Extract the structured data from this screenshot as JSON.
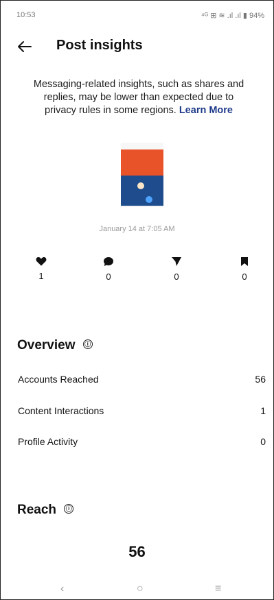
{
  "status_bar": {
    "time": "10:53",
    "indicators": "⁴ᴳ ⊞ ≋ .ıl .ıl ▮ 94%"
  },
  "header": {
    "title": "Post insights",
    "back_icon": "arrow-left-icon"
  },
  "notice": {
    "text": "Messaging-related insights, such as shares and replies, may be lower than expected due to privacy rules in some regions.",
    "link": "Learn More"
  },
  "post": {
    "date": "January 14 at 7:05 AM"
  },
  "stats": [
    {
      "icon": "heart-icon",
      "value": "1"
    },
    {
      "icon": "comment-icon",
      "value": "0"
    },
    {
      "icon": "share-icon",
      "value": "0"
    },
    {
      "icon": "bookmark-icon",
      "value": "0"
    }
  ],
  "overview": {
    "title": "Overview",
    "info_icon": "ⓘ",
    "rows": [
      {
        "label": "Accounts Reached",
        "value": "56"
      },
      {
        "label": "Content Interactions",
        "value": "1"
      },
      {
        "label": "Profile Activity",
        "value": "0"
      }
    ]
  },
  "reach": {
    "title": "Reach",
    "info_icon": "ⓘ",
    "total": "56"
  },
  "nav": {
    "back": "‹",
    "home": "○",
    "recents": "≡"
  },
  "colors": {
    "link": "#1e3a8a",
    "thumb_top": "#e8532a",
    "thumb_bottom": "#1e4c8c"
  }
}
